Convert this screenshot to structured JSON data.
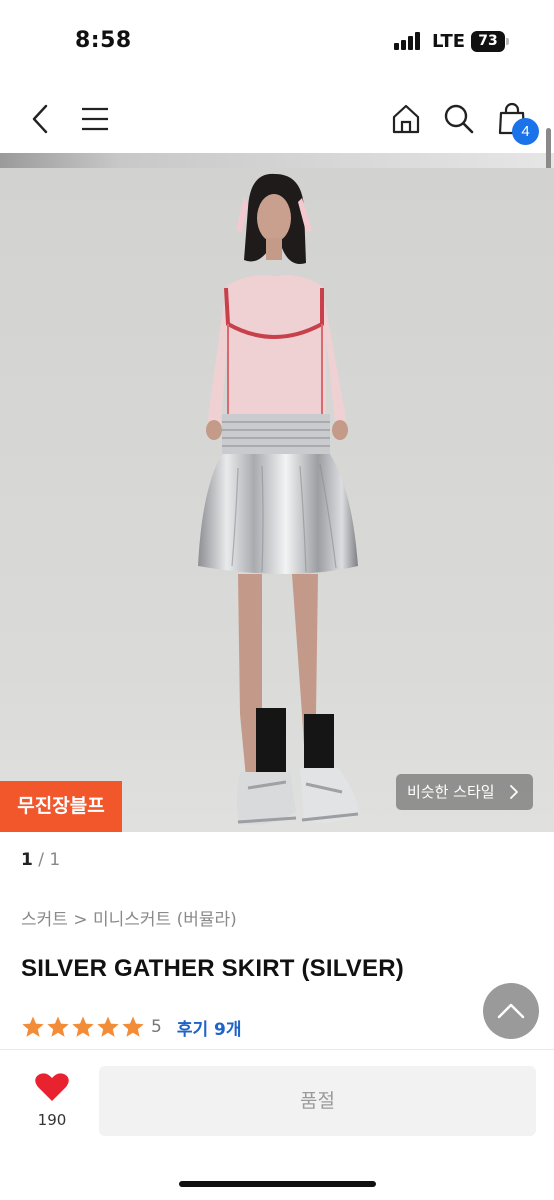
{
  "status_bar": {
    "time": "8:58",
    "network": "LTE",
    "battery": "73"
  },
  "nav": {
    "icons": [
      "back-icon",
      "menu-icon",
      "home-icon",
      "search-icon",
      "shopping-bag-icon"
    ],
    "cart_count": "4"
  },
  "image": {
    "exclusive_badge": "무진장블프",
    "similar_style": "비슷한 스타일"
  },
  "pager": {
    "current": "1",
    "separator": "/",
    "total": "1"
  },
  "product": {
    "breadcrumb": "스커트 > 미니스커트 (버뮬라)",
    "title": "SILVER GATHER SKIRT (SILVER)",
    "rating": 5,
    "rating_text": "5",
    "review_link": "후기 9개"
  },
  "actions": {
    "like_count": "190",
    "soldout_label": "품절"
  },
  "colors": {
    "accent_blue": "#1e63c7",
    "badge_orange": "#f1572b",
    "star": "#f28c38",
    "heart": "#e8222e"
  }
}
